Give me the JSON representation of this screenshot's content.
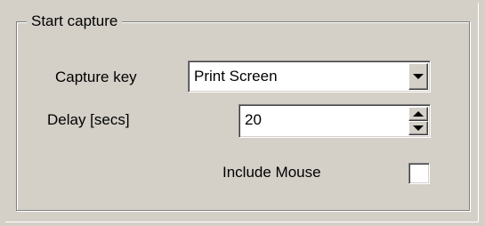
{
  "group": {
    "title": "Start capture"
  },
  "capture_key": {
    "label": "Capture key",
    "value": "Print Screen",
    "icon": "dropdown-arrow-icon"
  },
  "delay": {
    "label": "Delay [secs]",
    "value": "20",
    "icons": [
      "spin-up-icon",
      "spin-down-icon"
    ]
  },
  "include_mouse": {
    "label": "Include Mouse",
    "checked": false
  },
  "colors": {
    "face": "#d4d0c8",
    "shadow": "#808080",
    "highlight": "#ffffff",
    "field": "#ffffff"
  }
}
